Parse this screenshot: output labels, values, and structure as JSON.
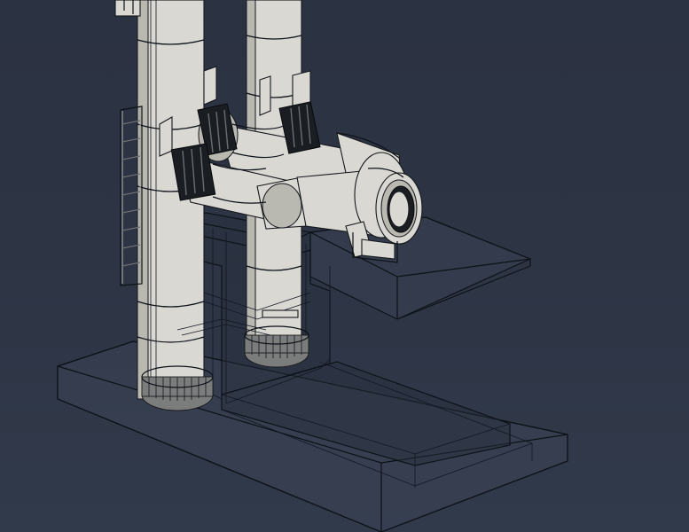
{
  "viewport": {
    "background_top": "#2b3241",
    "background_bottom": "#313a4b"
  },
  "scene": {
    "render_mode": "shaded-with-edges",
    "objects": [
      "tall-vertical-column",
      "second-vertical-column",
      "upper-bellows-duct",
      "lower-bellows-duct",
      "flanged-outlet-nozzle",
      "access-ladder",
      "transparent-concrete-foundation",
      "transparent-outlet-pad"
    ],
    "colors": {
      "equipment": "#d9d8d2",
      "edges": "#0d1118",
      "bellows": "#1a1d22",
      "foundation": "rgba(70,80,98,0.25)"
    }
  }
}
